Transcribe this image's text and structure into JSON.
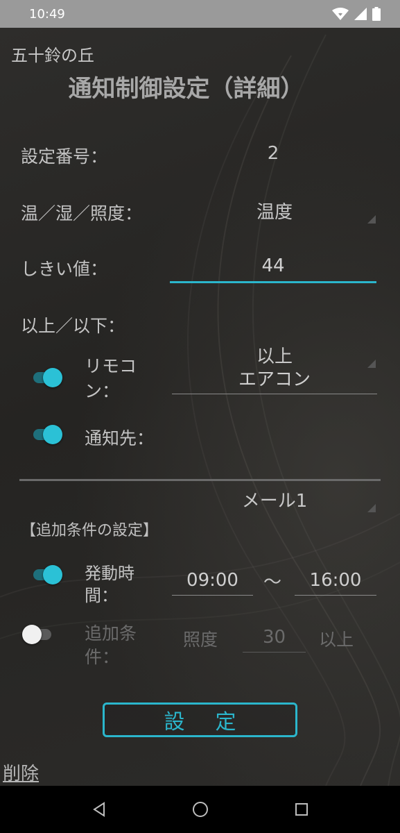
{
  "status_bar": {
    "time": "10:49"
  },
  "header": {
    "place_name": "五十鈴の丘",
    "title": "通知制御設定（詳細）"
  },
  "form": {
    "setting_number_label": "設定番号：",
    "setting_number_value": "2",
    "sensor_type_label": "温／湿／照度：",
    "sensor_type_value": "温度",
    "threshold_label": "しきい値：",
    "threshold_value": "44",
    "comparison_label": "以上／以下：",
    "comparison_value": "以上",
    "remote_label": "リモコン：",
    "remote_value": "エアコン",
    "remote_enabled": true,
    "notify_label": "通知先：",
    "notify_value": "メール1",
    "notify_enabled": true
  },
  "additional": {
    "section_title": "【追加条件の設定】",
    "active_time_label": "発動時間：",
    "active_time_enabled": true,
    "time_start": "09:00",
    "time_separator": "〜",
    "time_end": "16:00",
    "extra_condition_label": "追加条件：",
    "extra_condition_enabled": false,
    "extra_condition_type": "照度",
    "extra_condition_value": "30",
    "extra_condition_comparison": "以上"
  },
  "actions": {
    "set_label": "設定",
    "delete_label": "削除"
  },
  "colors": {
    "accent": "#2bb6cc",
    "background": "#2a2927"
  }
}
